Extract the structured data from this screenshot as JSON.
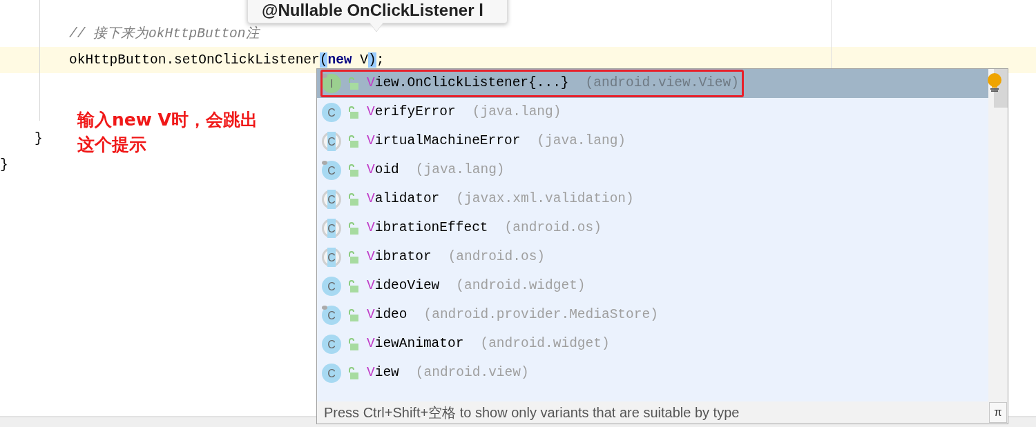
{
  "editor": {
    "comment": "// 接下来为okHttpButton注",
    "code_tokens": [
      {
        "text": "okHttpButton.setOnClickListener",
        "kind": "plain"
      },
      {
        "text": "(",
        "kind": "match"
      },
      {
        "text": "new",
        "kind": "keyword"
      },
      {
        "text": " V",
        "kind": "plain"
      },
      {
        "text": ")",
        "kind": "match"
      },
      {
        "text": ";",
        "kind": "plain"
      }
    ],
    "closing_braces": [
      "}",
      "}"
    ]
  },
  "annotation": {
    "text": "输入new V时，会跳出这个提示"
  },
  "tooltip": {
    "text": "@Nullable OnClickListener l"
  },
  "completion": {
    "items": [
      {
        "kind": "interface",
        "icon_letter": "I",
        "abstract": false,
        "pinned": true,
        "initial": "V",
        "name": "iew.OnClickListener",
        "suffix": "{...}",
        "package": "(android.view.View)",
        "selected": true
      },
      {
        "kind": "class",
        "icon_letter": "C",
        "abstract": false,
        "pinned": false,
        "initial": "V",
        "name": "erifyError",
        "package": "(java.lang)",
        "selected": false
      },
      {
        "kind": "class",
        "icon_letter": "C",
        "abstract": true,
        "pinned": false,
        "initial": "V",
        "name": "irtualMachineError",
        "package": "(java.lang)",
        "selected": false
      },
      {
        "kind": "class",
        "icon_letter": "C",
        "abstract": false,
        "pinned": true,
        "initial": "V",
        "name": "oid",
        "package": "(java.lang)",
        "selected": false
      },
      {
        "kind": "class",
        "icon_letter": "C",
        "abstract": true,
        "pinned": false,
        "initial": "V",
        "name": "alidator",
        "package": "(javax.xml.validation)",
        "selected": false
      },
      {
        "kind": "class",
        "icon_letter": "C",
        "abstract": true,
        "pinned": false,
        "initial": "V",
        "name": "ibrationEffect",
        "package": "(android.os)",
        "selected": false
      },
      {
        "kind": "class",
        "icon_letter": "C",
        "abstract": true,
        "pinned": false,
        "initial": "V",
        "name": "ibrator",
        "package": "(android.os)",
        "selected": false
      },
      {
        "kind": "class",
        "icon_letter": "C",
        "abstract": false,
        "pinned": false,
        "initial": "V",
        "name": "ideoView",
        "package": "(android.widget)",
        "selected": false
      },
      {
        "kind": "class",
        "icon_letter": "C",
        "abstract": false,
        "pinned": true,
        "initial": "V",
        "name": "ideo",
        "package": "(android.provider.MediaStore)",
        "selected": false
      },
      {
        "kind": "class",
        "icon_letter": "C",
        "abstract": false,
        "pinned": false,
        "initial": "V",
        "name": "iewAnimator",
        "package": "(android.widget)",
        "selected": false
      },
      {
        "kind": "class",
        "icon_letter": "C",
        "abstract": false,
        "pinned": false,
        "initial": "V",
        "name": "iew",
        "package": "(android.view)",
        "selected": false
      }
    ],
    "footer": "Press Ctrl+Shift+空格 to show only variants that are suitable by type",
    "pin_button": "π"
  }
}
